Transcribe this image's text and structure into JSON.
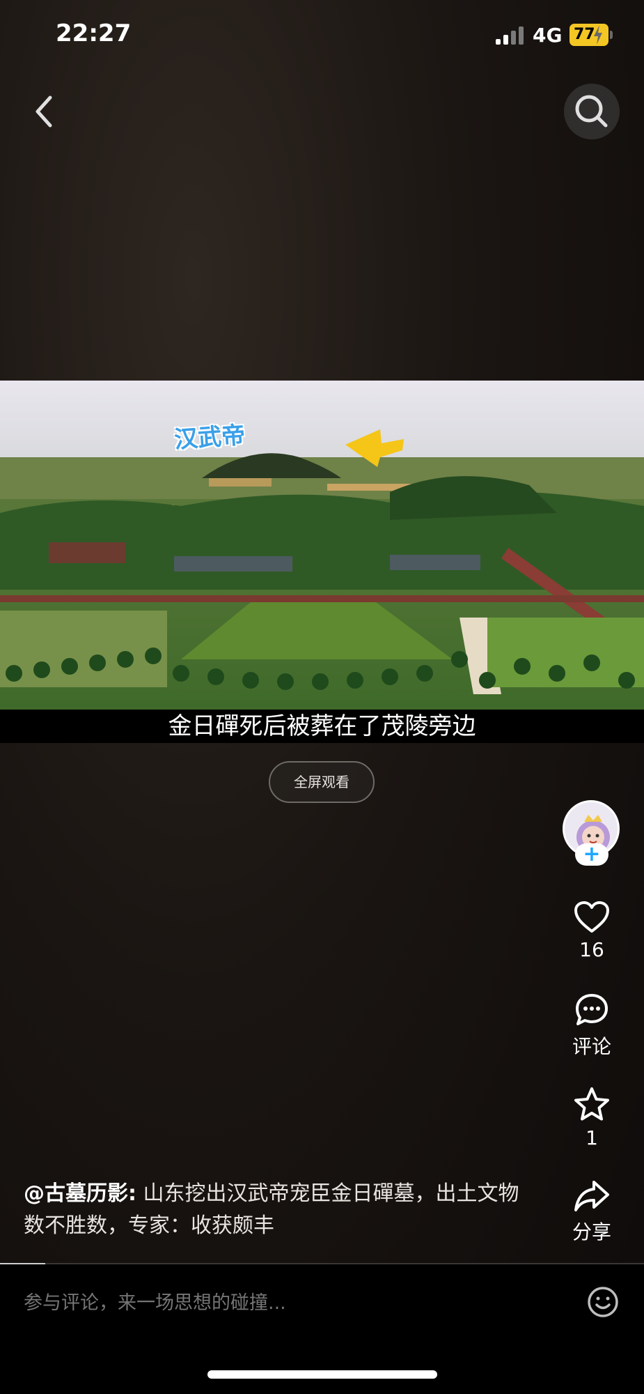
{
  "status_bar": {
    "time": "22:27",
    "network": "4G",
    "battery": "77"
  },
  "nav": {
    "back_icon": "chevron-left-icon",
    "search_icon": "search-icon"
  },
  "video": {
    "overlay_label": "汉武帝",
    "subtitle": "金日磾死后被葬在了茂陵旁边",
    "fullscreen_label": "全屏观看",
    "progress": 0.07
  },
  "sidebar": {
    "follow_icon": "plus-icon",
    "like_count": "16",
    "comment_label": "评论",
    "favorite_count": "1",
    "share_label": "分享"
  },
  "post": {
    "author": "@古墓历影:",
    "caption": "山东挖出汉武帝宠臣金日磾墓，出土文物数不胜数，专家：收获颇丰"
  },
  "comment_bar": {
    "placeholder": "参与评论，来一场思想的碰撞..."
  },
  "colors": {
    "accent": "#1fa7ff",
    "battery": "#f4c624",
    "arrow": "#f5c518"
  }
}
